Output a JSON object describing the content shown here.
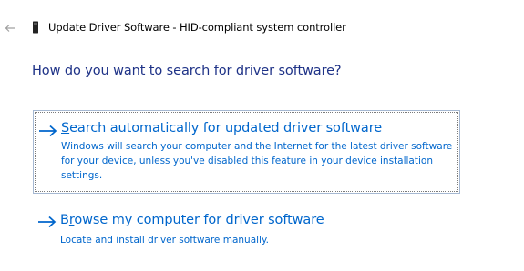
{
  "window": {
    "title": "Update Driver Software - HID-compliant system controller",
    "back_icon": "back-arrow-icon",
    "device_icon": "device-icon"
  },
  "main": {
    "heading": "How do you want to search for driver software?",
    "options": [
      {
        "label": "Search automatically for updated driver software",
        "mnemonic": "S",
        "description": "Windows will search your computer and the Internet for the latest driver software for your device, unless you've disabled this feature in your device installation settings.",
        "selected": true
      },
      {
        "label": "Browse my computer for driver software",
        "mnemonic": "r",
        "description": "Locate and install driver software manually.",
        "selected": false
      }
    ]
  },
  "colors": {
    "heading": "#1e3287",
    "link": "#0066cc",
    "selection_border": "#a5b8d2"
  }
}
